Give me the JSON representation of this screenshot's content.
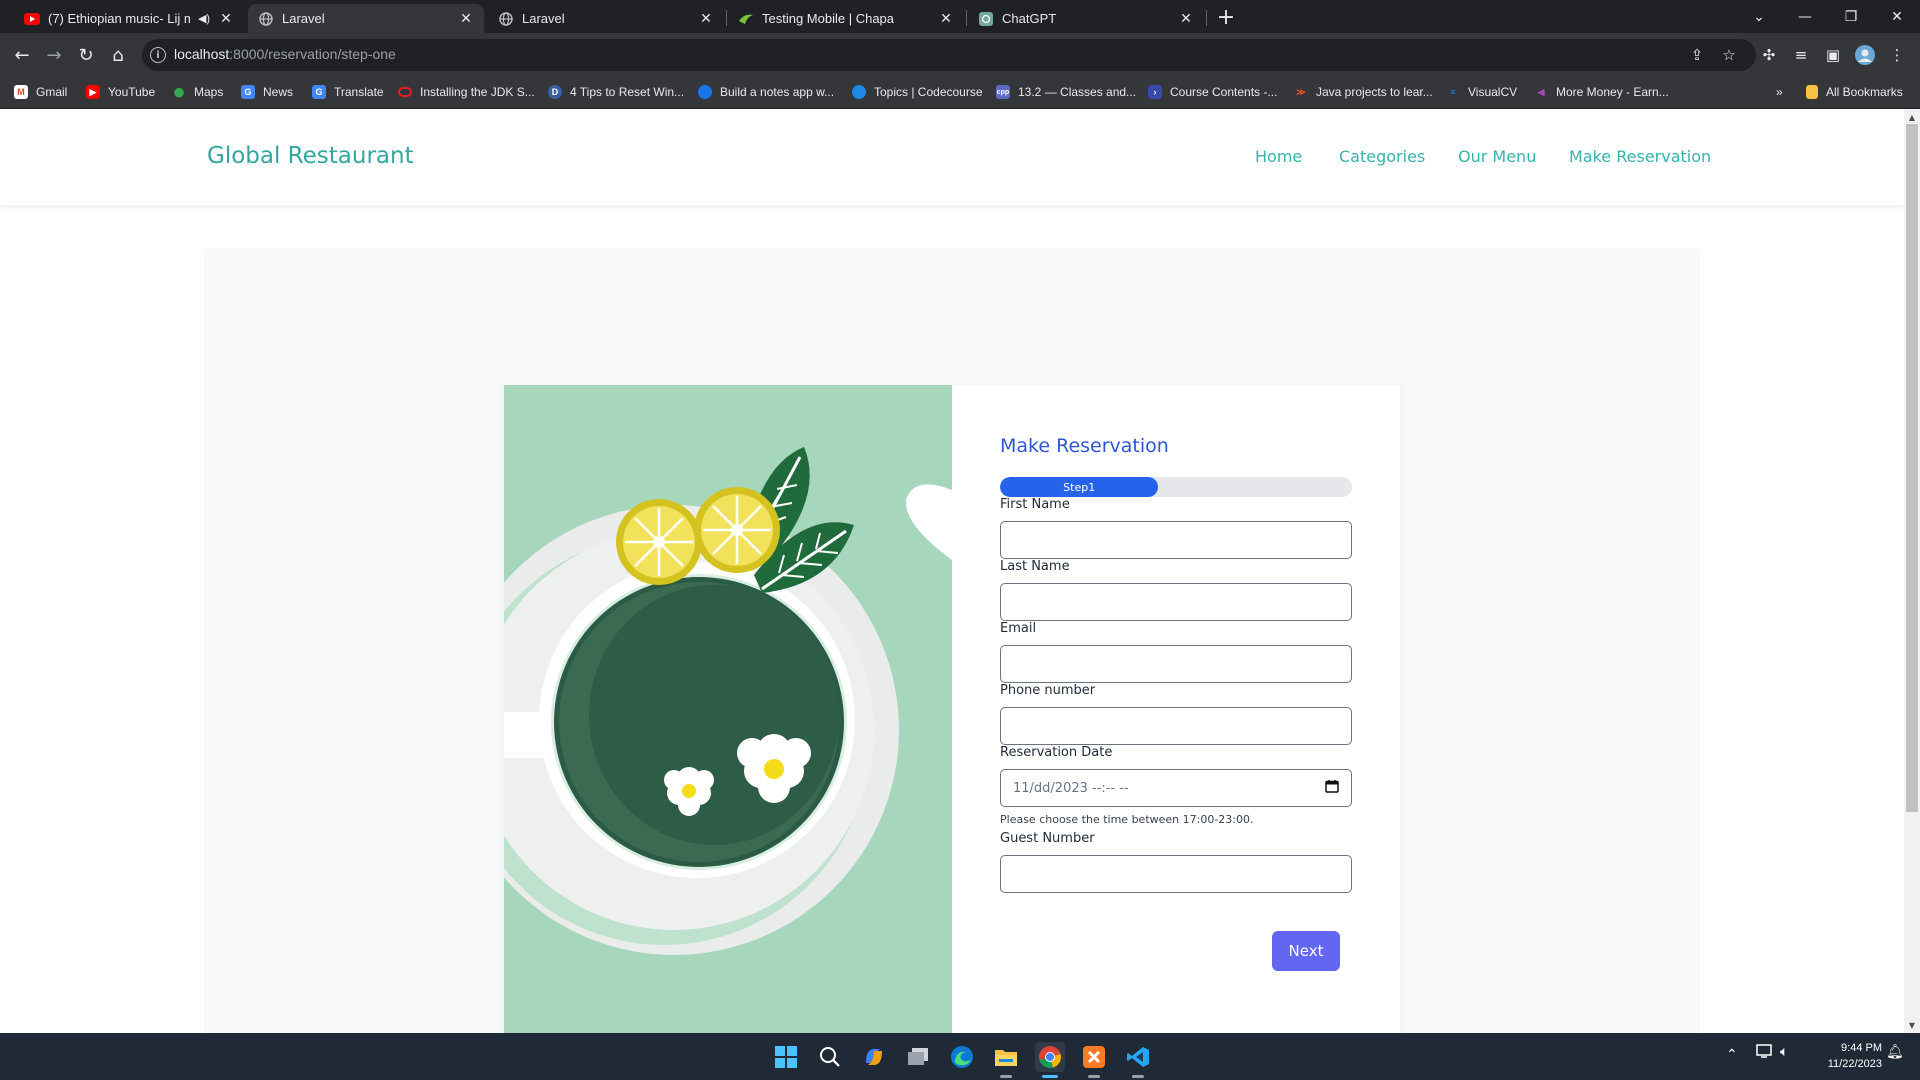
{
  "browser": {
    "tabs": [
      {
        "title": "(7) Ethiopian music- Lij mic",
        "favicon": "youtube-icon",
        "muted_icon": "speaker-icon"
      },
      {
        "title": "Laravel",
        "favicon": "globe-icon"
      },
      {
        "title": "Laravel",
        "favicon": "globe-icon"
      },
      {
        "title": "Testing Mobile | Chapa",
        "favicon": "chapa-icon"
      },
      {
        "title": "ChatGPT",
        "favicon": "chatgpt-icon"
      }
    ],
    "active_tab_index": 1,
    "address": {
      "host": "localhost",
      "path": ":8000/reservation/step-one"
    },
    "bookmarks": [
      {
        "label": "Gmail",
        "icon": "gmail-icon"
      },
      {
        "label": "YouTube",
        "icon": "youtube-icon"
      },
      {
        "label": "Maps",
        "icon": "maps-icon"
      },
      {
        "label": "News",
        "icon": "news-icon"
      },
      {
        "label": "Translate",
        "icon": "translate-icon"
      },
      {
        "label": "Installing the JDK S...",
        "icon": "oracle-icon"
      },
      {
        "label": "4 Tips to Reset Win...",
        "icon": "d-icon"
      },
      {
        "label": "Build a notes app w...",
        "icon": "blue-circle-icon"
      },
      {
        "label": "Topics | Codecourse",
        "icon": "codecourse-icon"
      },
      {
        "label": "13.2 — Classes and...",
        "icon": "cpp-icon"
      },
      {
        "label": "Course Contents -...",
        "icon": "terminal-icon"
      },
      {
        "label": "Java projects to lear...",
        "icon": "orange-icon"
      },
      {
        "label": "VisualCV",
        "icon": "visualcv-icon"
      },
      {
        "label": "More Money - Earn...",
        "icon": "purple-icon"
      }
    ],
    "bookmarks_overflow": "»",
    "all_bookmarks": "All Bookmarks"
  },
  "site": {
    "brand": "Global Restaurant",
    "nav": [
      "Home",
      "Categories",
      "Our Menu",
      "Make Reservation"
    ]
  },
  "form": {
    "title": "Make Reservation",
    "progress_label": "Step1",
    "progress_fraction": 0.45,
    "fields": {
      "first_name": {
        "label": "First Name",
        "value": ""
      },
      "last_name": {
        "label": "Last Name",
        "value": ""
      },
      "email": {
        "label": "Email",
        "value": ""
      },
      "phone": {
        "label": "Phone number",
        "value": ""
      },
      "date": {
        "label": "Reservation Date",
        "value": "11/dd/2023 --:-- --",
        "help": "Please choose the time between 17:00-23:00."
      },
      "guests": {
        "label": "Guest Number",
        "value": ""
      }
    },
    "next_label": "Next"
  },
  "colors": {
    "brand": "#32a7a0",
    "title_blue": "#2f55d4",
    "progress": "#2563eb",
    "next_button": "#6366f1",
    "illustration_bg": "#a6d6bb"
  },
  "taskbar": {
    "apps": [
      "windows-start-icon",
      "search-icon",
      "copilot-icon",
      "task-view-icon",
      "edge-icon",
      "file-explorer-icon",
      "chrome-icon",
      "xampp-icon",
      "vscode-icon"
    ],
    "time": "9:44 PM",
    "date": "11/22/2023"
  }
}
